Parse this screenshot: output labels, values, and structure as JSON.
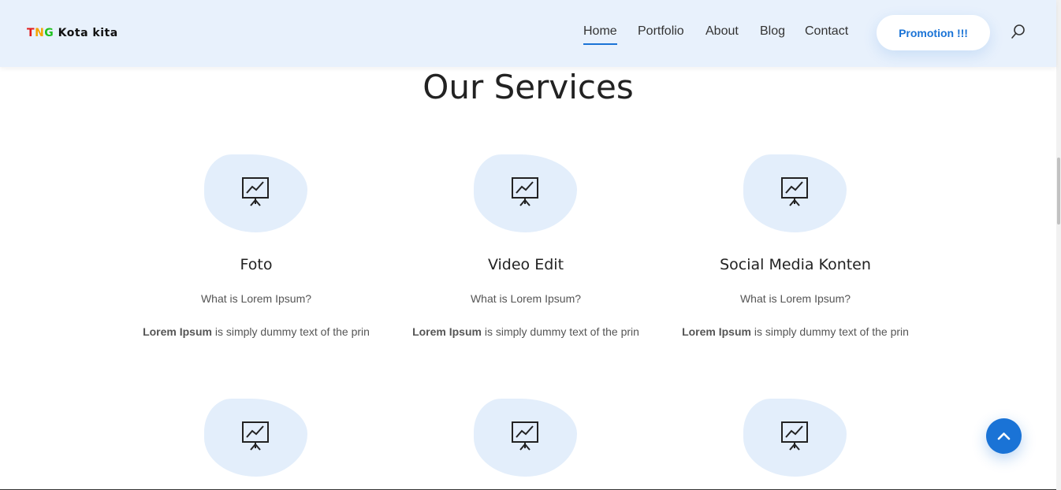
{
  "header": {
    "logo": {
      "t": "T",
      "n": "N",
      "g": "G",
      "rest": " Kota kita"
    },
    "nav": [
      {
        "label": "Home",
        "active": true
      },
      {
        "label": "Portfolio",
        "active": false
      },
      {
        "label": "About",
        "active": false
      },
      {
        "label": "Blog",
        "active": false
      },
      {
        "label": "Contact",
        "active": false
      }
    ],
    "promo_label": "Promotion !!!",
    "search_icon": "search-icon"
  },
  "services": {
    "title": "Our Services",
    "cards": [
      {
        "icon": "presentation-chart-icon",
        "title": "Foto",
        "subtitle": "What is Lorem Ipsum?",
        "text_bold": "Lorem Ipsum",
        "text": " is simply dummy text of the prin"
      },
      {
        "icon": "presentation-chart-icon",
        "title": "Video Edit",
        "subtitle": "What is Lorem Ipsum?",
        "text_bold": "Lorem Ipsum",
        "text": " is simply dummy text of the prin"
      },
      {
        "icon": "presentation-chart-icon",
        "title": "Social Media Konten",
        "subtitle": "What is Lorem Ipsum?",
        "text_bold": "Lorem Ipsum",
        "text": " is simply dummy text of the prin"
      },
      {
        "icon": "presentation-chart-icon"
      },
      {
        "icon": "presentation-chart-icon"
      },
      {
        "icon": "presentation-chart-icon"
      }
    ]
  },
  "back_to_top_icon": "chevron-up-icon",
  "colors": {
    "accent": "#1a73d6",
    "header_bg": "#e8f1fc",
    "blob_bg": "#e3eefb"
  }
}
